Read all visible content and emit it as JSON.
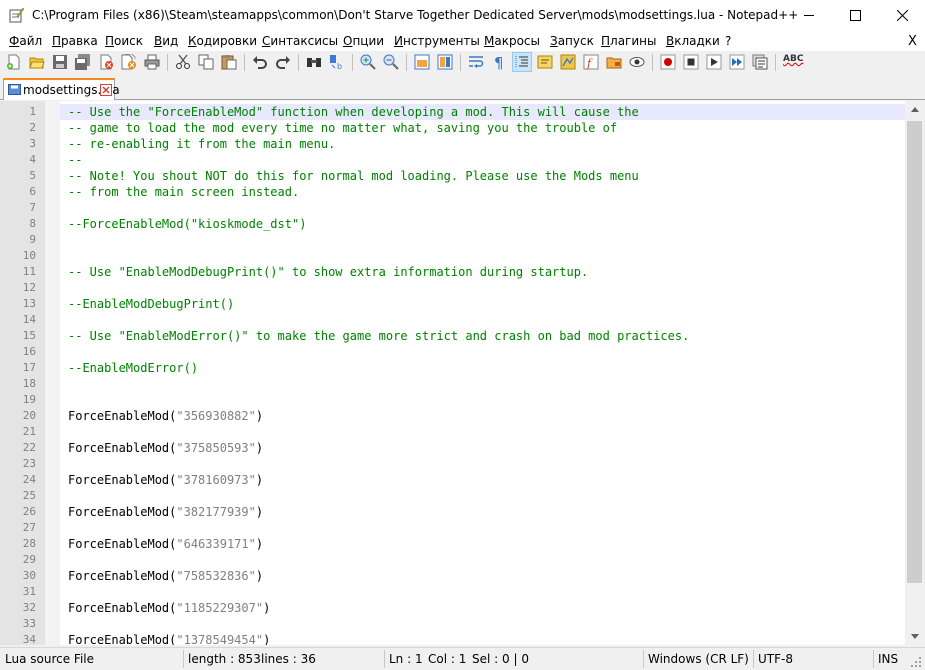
{
  "window": {
    "title": "C:\\Program Files (x86)\\Steam\\steamapps\\common\\Don't Starve Together Dedicated Server\\mods\\modsettings.lua - Notepad++",
    "minimize": "—",
    "maximize": "☐",
    "close": "✕"
  },
  "menu": {
    "items": [
      "Файл",
      "Правка",
      "Поиск",
      "Вид",
      "Кодировки",
      "Синтаксисы",
      "Опции",
      "Инструменты",
      "Макросы",
      "Запуск",
      "Плагины",
      "Вкладки",
      "?"
    ],
    "close": "X"
  },
  "tab": {
    "label": "modsettings.lua"
  },
  "editor": {
    "lines": [
      {
        "n": "1",
        "parts": [
          {
            "t": "-- Use the \"ForceEnableMod\" function when developing a mod. This will cause the",
            "c": "com"
          }
        ]
      },
      {
        "n": "2",
        "parts": [
          {
            "t": "-- game to load the mod every time no matter what, saving you the trouble of",
            "c": "com"
          }
        ]
      },
      {
        "n": "3",
        "parts": [
          {
            "t": "-- re-enabling it from the main menu.",
            "c": "com"
          }
        ]
      },
      {
        "n": "4",
        "parts": [
          {
            "t": "--",
            "c": "com"
          }
        ]
      },
      {
        "n": "5",
        "parts": [
          {
            "t": "-- Note! You shout NOT do this for normal mod loading. Please use the Mods menu",
            "c": "com"
          }
        ]
      },
      {
        "n": "6",
        "parts": [
          {
            "t": "-- from the main screen instead.",
            "c": "com"
          }
        ]
      },
      {
        "n": "7",
        "parts": []
      },
      {
        "n": "8",
        "parts": [
          {
            "t": "--ForceEnableMod(\"kioskmode_dst\")",
            "c": "com"
          }
        ]
      },
      {
        "n": "9",
        "parts": []
      },
      {
        "n": "10",
        "parts": []
      },
      {
        "n": "11",
        "parts": [
          {
            "t": "-- Use \"EnableModDebugPrint()\" to show extra information during startup.",
            "c": "com"
          }
        ]
      },
      {
        "n": "12",
        "parts": []
      },
      {
        "n": "13",
        "parts": [
          {
            "t": "--EnableModDebugPrint()",
            "c": "com"
          }
        ]
      },
      {
        "n": "14",
        "parts": []
      },
      {
        "n": "15",
        "parts": [
          {
            "t": "-- Use \"EnableModError()\" to make the game more strict and crash on bad mod practices.",
            "c": "com"
          }
        ]
      },
      {
        "n": "16",
        "parts": []
      },
      {
        "n": "17",
        "parts": [
          {
            "t": "--EnableModError()",
            "c": "com"
          }
        ]
      },
      {
        "n": "18",
        "parts": []
      },
      {
        "n": "19",
        "parts": []
      },
      {
        "n": "20",
        "parts": [
          {
            "t": "ForceEnableMod(",
            "c": "plain"
          },
          {
            "t": "\"356930882\"",
            "c": "str"
          },
          {
            "t": ")",
            "c": "plain"
          }
        ]
      },
      {
        "n": "21",
        "parts": []
      },
      {
        "n": "22",
        "parts": [
          {
            "t": "ForceEnableMod(",
            "c": "plain"
          },
          {
            "t": "\"375850593\"",
            "c": "str"
          },
          {
            "t": ")",
            "c": "plain"
          }
        ]
      },
      {
        "n": "23",
        "parts": []
      },
      {
        "n": "24",
        "parts": [
          {
            "t": "ForceEnableMod(",
            "c": "plain"
          },
          {
            "t": "\"378160973\"",
            "c": "str"
          },
          {
            "t": ")",
            "c": "plain"
          }
        ]
      },
      {
        "n": "25",
        "parts": []
      },
      {
        "n": "26",
        "parts": [
          {
            "t": "ForceEnableMod(",
            "c": "plain"
          },
          {
            "t": "\"382177939\"",
            "c": "str"
          },
          {
            "t": ")",
            "c": "plain"
          }
        ]
      },
      {
        "n": "27",
        "parts": []
      },
      {
        "n": "28",
        "parts": [
          {
            "t": "ForceEnableMod(",
            "c": "plain"
          },
          {
            "t": "\"646339171\"",
            "c": "str"
          },
          {
            "t": ")",
            "c": "plain"
          }
        ]
      },
      {
        "n": "29",
        "parts": []
      },
      {
        "n": "30",
        "parts": [
          {
            "t": "ForceEnableMod(",
            "c": "plain"
          },
          {
            "t": "\"758532836\"",
            "c": "str"
          },
          {
            "t": ")",
            "c": "plain"
          }
        ]
      },
      {
        "n": "31",
        "parts": []
      },
      {
        "n": "32",
        "parts": [
          {
            "t": "ForceEnableMod(",
            "c": "plain"
          },
          {
            "t": "\"1185229307\"",
            "c": "str"
          },
          {
            "t": ")",
            "c": "plain"
          }
        ]
      },
      {
        "n": "33",
        "parts": []
      },
      {
        "n": "34",
        "parts": [
          {
            "t": "ForceEnableMod(",
            "c": "plain"
          },
          {
            "t": "\"1378549454\"",
            "c": "str"
          },
          {
            "t": ")",
            "c": "plain"
          }
        ]
      }
    ]
  },
  "status": {
    "filetype": "Lua source File",
    "length": "length : 853",
    "lines": "lines : 36",
    "ln": "Ln : 1",
    "col": "Col : 1",
    "sel": "Sel : 0 | 0",
    "eol": "Windows (CR LF)",
    "encoding": "UTF-8",
    "mode": "INS"
  },
  "colors": {
    "comment": "#008000",
    "string": "#808080",
    "current_line": "#e8e8ff",
    "tab_accent": "#fa8a1c"
  },
  "icons": {
    "toolbar": [
      "new-file-icon",
      "open-file-icon",
      "save-icon",
      "save-all-icon",
      "close-icon",
      "close-all-icon",
      "print-icon",
      "cut-icon",
      "copy-icon",
      "paste-icon",
      "undo-icon",
      "redo-icon",
      "find-icon",
      "replace-icon",
      "zoom-in-icon",
      "zoom-out-icon",
      "sync-vertical-icon",
      "sync-horizontal-icon",
      "word-wrap-icon",
      "show-all-chars-icon",
      "indent-guide-icon",
      "user-language-icon",
      "doc-map-icon",
      "function-list-icon",
      "folder-workspace-icon",
      "monitoring-icon",
      "record-macro-icon",
      "stop-record-icon",
      "play-macro-icon",
      "play-multiple-icon",
      "save-macro-icon",
      "spell-check-icon"
    ],
    "spellcheck_label": "ABC"
  }
}
